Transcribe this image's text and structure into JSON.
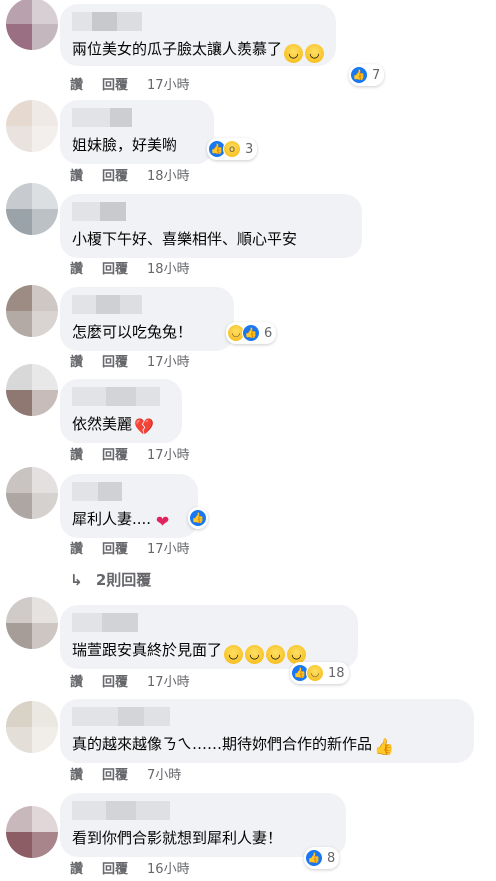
{
  "comments": [
    {
      "text": "兩位美女的瓜子臉太讓人羨慕了",
      "text_emojis": [
        "grin",
        "grin"
      ],
      "reactions": [
        "like"
      ],
      "reaction_count": "7",
      "like_label": "讚",
      "reply_label": "回覆",
      "time": "17小時"
    },
    {
      "text": "姐妹臉，好美喲",
      "reactions": [
        "like",
        "wow"
      ],
      "reaction_count": "3",
      "like_label": "讚",
      "reply_label": "回覆",
      "time": "18小時"
    },
    {
      "text": "小榎下午好、喜樂相伴、順心平安",
      "like_label": "讚",
      "reply_label": "回覆",
      "time": "18小時"
    },
    {
      "text": "怎麼可以吃兔兔！",
      "reactions": [
        "haha",
        "like"
      ],
      "reaction_count": "6",
      "like_label": "讚",
      "reply_label": "回覆",
      "time": "17小時"
    },
    {
      "text": "依然美麗",
      "text_emojis": [
        "heart-break"
      ],
      "like_label": "讚",
      "reply_label": "回覆",
      "time": "17小時"
    },
    {
      "text": "犀利人妻....",
      "text_emojis": [
        "heart"
      ],
      "reactions": [
        "like"
      ],
      "like_label": "讚",
      "reply_label": "回覆",
      "time": "17小時"
    },
    {
      "text": "瑞萱跟安真終於見面了",
      "text_emojis": [
        "grin",
        "grin",
        "grin",
        "grin"
      ],
      "reactions": [
        "like",
        "haha"
      ],
      "reaction_count": "18",
      "like_label": "讚",
      "reply_label": "回覆",
      "time": "17小時"
    },
    {
      "text": "真的越來越像ㄋㄟ……期待妳們合作的新作品",
      "text_emojis": [
        "thumbs-up"
      ],
      "like_label": "讚",
      "reply_label": "回覆",
      "time": "7小時"
    },
    {
      "text": "看到你們合影就想到犀利人妻！",
      "reactions": [
        "like"
      ],
      "reaction_count": "8",
      "like_label": "讚",
      "reply_label": "回覆",
      "time": "16小時"
    }
  ],
  "view_replies": {
    "icon": "reply-arrow-icon",
    "arrow": "↳",
    "label": "2則回覆"
  },
  "colors": {
    "bubble": "#f0f2f5",
    "meta_text": "#65676b",
    "like_blue": "#1877f2"
  }
}
